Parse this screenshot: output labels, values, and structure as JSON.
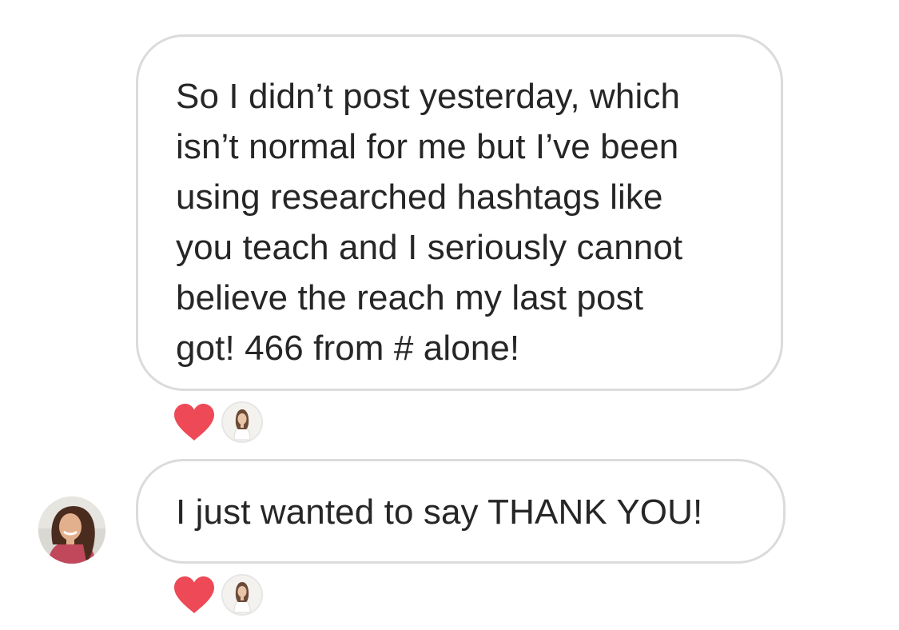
{
  "messages": [
    {
      "lines": [
        "So I didn’t post yesterday, which",
        "isn’t normal for me but I’ve been",
        "using researched hashtags like",
        "you teach and I seriously cannot",
        "believe the reach my last post",
        "got!  466 from # alone!"
      ],
      "reaction": "heart-icon"
    },
    {
      "lines": [
        "I just wanted to say THANK YOU!"
      ],
      "reaction": "heart-icon"
    }
  ],
  "colors": {
    "bubble_border": "#dbdbdb",
    "text": "#262626",
    "heart": "#ed4956"
  }
}
